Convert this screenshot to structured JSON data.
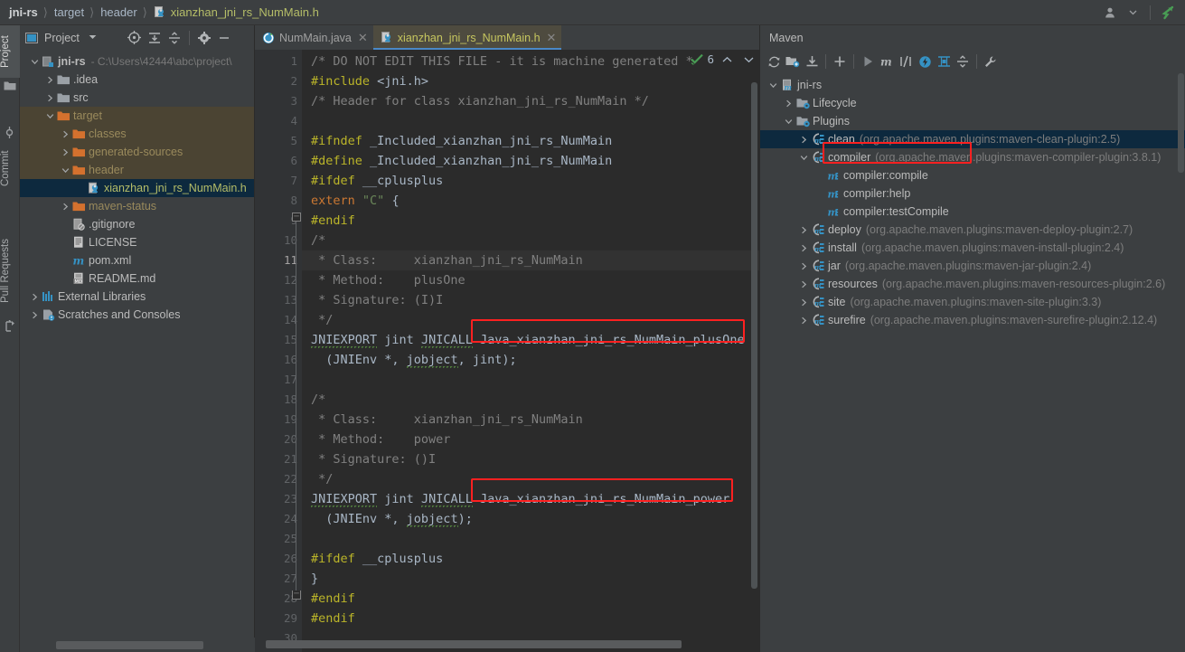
{
  "breadcrumb": {
    "items": [
      {
        "label": "jni-rs",
        "type": "module"
      },
      {
        "label": "target",
        "type": "folder"
      },
      {
        "label": "header",
        "type": "folder"
      },
      {
        "label": "xianzhan_jni_rs_NumMain.h",
        "type": "file"
      }
    ],
    "separator": "〉"
  },
  "topbar_right": {
    "account_icon": "user-icon",
    "chevron": "chevron-down-icon",
    "vcs_icon": "vcs-arrow-icon"
  },
  "left_strip": {
    "items": [
      {
        "label": "Project",
        "active": true,
        "icon": "project-icon"
      },
      {
        "label": "Commit",
        "active": false,
        "icon": "commit-icon"
      },
      {
        "label": "Pull Requests",
        "active": false,
        "icon": "pull-request-icon"
      }
    ]
  },
  "project_panel": {
    "title": "Project",
    "toolbar": [
      {
        "name": "select-opened-file-icon",
        "glyph": "target"
      },
      {
        "name": "expand-all-icon",
        "glyph": "expand"
      },
      {
        "name": "collapse-all-icon",
        "glyph": "collapse"
      },
      {
        "name": "settings-icon",
        "glyph": "gear"
      },
      {
        "name": "hide-icon",
        "glyph": "minus"
      }
    ],
    "tree": [
      {
        "indent": 0,
        "arrow": "down",
        "icon": "module-icon",
        "label": "jni-rs",
        "sub": "- C:\\Users\\42444\\abc\\project\\",
        "bold": true,
        "excluded": false,
        "selected": false
      },
      {
        "indent": 1,
        "arrow": "right",
        "icon": "folder-icon",
        "label": ".idea",
        "sub": "",
        "bold": false,
        "excluded": false,
        "selected": false
      },
      {
        "indent": 1,
        "arrow": "right",
        "icon": "folder-icon",
        "label": "src",
        "sub": "",
        "bold": false,
        "excluded": false,
        "selected": false
      },
      {
        "indent": 1,
        "arrow": "down",
        "icon": "folder-orange-icon",
        "label": "target",
        "sub": "",
        "bold": false,
        "excluded": true,
        "selected": false
      },
      {
        "indent": 2,
        "arrow": "right",
        "icon": "folder-orange-icon",
        "label": "classes",
        "sub": "",
        "bold": false,
        "excluded": true,
        "selected": false
      },
      {
        "indent": 2,
        "arrow": "right",
        "icon": "folder-orange-icon",
        "label": "generated-sources",
        "sub": "",
        "bold": false,
        "excluded": true,
        "selected": false
      },
      {
        "indent": 2,
        "arrow": "down",
        "icon": "folder-orange-icon",
        "label": "header",
        "sub": "",
        "bold": false,
        "excluded": true,
        "selected": false
      },
      {
        "indent": 3,
        "arrow": "none",
        "icon": "header-file-icon",
        "label": "xianzhan_jni_rs_NumMain.h",
        "sub": "",
        "bold": false,
        "excluded": false,
        "selected": true
      },
      {
        "indent": 2,
        "arrow": "right",
        "icon": "folder-orange-icon",
        "label": "maven-status",
        "sub": "",
        "bold": false,
        "excluded": true,
        "selected": false
      },
      {
        "indent": 2,
        "arrow": "none",
        "icon": "gitignore-icon",
        "label": ".gitignore",
        "sub": "",
        "bold": false,
        "excluded": false,
        "selected": false
      },
      {
        "indent": 2,
        "arrow": "none",
        "icon": "text-file-icon",
        "label": "LICENSE",
        "sub": "",
        "bold": false,
        "excluded": false,
        "selected": false
      },
      {
        "indent": 2,
        "arrow": "none",
        "icon": "maven-m-icon",
        "label": "pom.xml",
        "sub": "",
        "bold": false,
        "excluded": false,
        "selected": false
      },
      {
        "indent": 2,
        "arrow": "none",
        "icon": "markdown-icon",
        "label": "README.md",
        "sub": "",
        "bold": false,
        "excluded": false,
        "selected": false
      },
      {
        "indent": 0,
        "arrow": "right",
        "icon": "libraries-icon",
        "label": "External Libraries",
        "sub": "",
        "bold": false,
        "excluded": false,
        "selected": false
      },
      {
        "indent": 0,
        "arrow": "right",
        "icon": "scratches-icon",
        "label": "Scratches and Consoles",
        "sub": "",
        "bold": false,
        "excluded": false,
        "selected": false
      }
    ]
  },
  "editor": {
    "tabs": [
      {
        "label": "NumMain.java",
        "icon": "java-class-icon",
        "active": false,
        "closable": true
      },
      {
        "label": "xianzhan_jni_rs_NumMain.h",
        "icon": "header-file-icon",
        "active": true,
        "closable": true
      }
    ],
    "inspection_widget": {
      "count": "6",
      "icon": "checkmark-green-icon",
      "up": "⌃",
      "down": "⌄"
    },
    "current_line": 11,
    "lines": [
      {
        "n": 1,
        "tokens": [
          {
            "c": "cmt",
            "t": "/* DO NOT EDIT THIS FILE - it is machine generated *"
          }
        ]
      },
      {
        "n": 2,
        "tokens": [
          {
            "c": "pp",
            "t": "#include"
          },
          {
            "c": "txt",
            "t": " <jni.h>"
          }
        ]
      },
      {
        "n": 3,
        "tokens": [
          {
            "c": "cmt",
            "t": "/* Header for class xianzhan_jni_rs_NumMain */"
          }
        ]
      },
      {
        "n": 4,
        "tokens": []
      },
      {
        "n": 5,
        "tokens": [
          {
            "c": "pp",
            "t": "#ifndef"
          },
          {
            "c": "txt",
            "t": " _Included_xianzhan_jni_rs_NumMain"
          }
        ]
      },
      {
        "n": 6,
        "tokens": [
          {
            "c": "pp",
            "t": "#define"
          },
          {
            "c": "txt",
            "t": " _Included_xianzhan_jni_rs_NumMain"
          }
        ]
      },
      {
        "n": 7,
        "tokens": [
          {
            "c": "pp",
            "t": "#ifdef"
          },
          {
            "c": "txt",
            "t": " __cplusplus"
          }
        ]
      },
      {
        "n": 8,
        "tokens": [
          {
            "c": "kw",
            "t": "extern"
          },
          {
            "c": "txt",
            "t": " "
          },
          {
            "c": "str",
            "t": "\"C\""
          },
          {
            "c": "txt",
            "t": " {"
          }
        ]
      },
      {
        "n": 9,
        "tokens": [
          {
            "c": "pp",
            "t": "#endif"
          }
        ]
      },
      {
        "n": 10,
        "tokens": [
          {
            "c": "cmt",
            "t": "/*"
          }
        ]
      },
      {
        "n": 11,
        "tokens": [
          {
            "c": "cmt",
            "t": " * Class:     xianzhan_jni_rs_NumMain"
          }
        ]
      },
      {
        "n": 12,
        "tokens": [
          {
            "c": "cmt",
            "t": " * Method:    plusOne"
          }
        ]
      },
      {
        "n": 13,
        "tokens": [
          {
            "c": "cmt",
            "t": " * Signature: (I)I"
          }
        ]
      },
      {
        "n": 14,
        "tokens": [
          {
            "c": "cmt",
            "t": " */"
          }
        ]
      },
      {
        "n": 15,
        "tokens": [
          {
            "c": "txt wavy",
            "t": "JNIEXPORT"
          },
          {
            "c": "txt",
            "t": " jint "
          },
          {
            "c": "txt wavy",
            "t": "JNICALL"
          },
          {
            "c": "txt",
            "t": " Java_xianzhan_jni_rs_NumMain_plusOne"
          }
        ]
      },
      {
        "n": 16,
        "tokens": [
          {
            "c": "txt",
            "t": "  (JNIEnv *, "
          },
          {
            "c": "txt wavy",
            "t": "jobject"
          },
          {
            "c": "txt",
            "t": ", jint);"
          }
        ]
      },
      {
        "n": 17,
        "tokens": []
      },
      {
        "n": 18,
        "tokens": [
          {
            "c": "cmt",
            "t": "/*"
          }
        ]
      },
      {
        "n": 19,
        "tokens": [
          {
            "c": "cmt",
            "t": " * Class:     xianzhan_jni_rs_NumMain"
          }
        ]
      },
      {
        "n": 20,
        "tokens": [
          {
            "c": "cmt",
            "t": " * Method:    power"
          }
        ]
      },
      {
        "n": 21,
        "tokens": [
          {
            "c": "cmt",
            "t": " * Signature: ()I"
          }
        ]
      },
      {
        "n": 22,
        "tokens": [
          {
            "c": "cmt",
            "t": " */"
          }
        ]
      },
      {
        "n": 23,
        "tokens": [
          {
            "c": "txt wavy",
            "t": "JNIEXPORT"
          },
          {
            "c": "txt",
            "t": " jint "
          },
          {
            "c": "txt wavy",
            "t": "JNICALL"
          },
          {
            "c": "txt",
            "t": " Java_xianzhan_jni_rs_NumMain_power"
          }
        ]
      },
      {
        "n": 24,
        "tokens": [
          {
            "c": "txt",
            "t": "  (JNIEnv *, "
          },
          {
            "c": "txt wavy",
            "t": "jobject"
          },
          {
            "c": "txt",
            "t": ");"
          }
        ]
      },
      {
        "n": 25,
        "tokens": []
      },
      {
        "n": 26,
        "tokens": [
          {
            "c": "pp",
            "t": "#ifdef"
          },
          {
            "c": "txt",
            "t": " __cplusplus"
          }
        ]
      },
      {
        "n": 27,
        "tokens": [
          {
            "c": "txt",
            "t": "}"
          }
        ]
      },
      {
        "n": 28,
        "tokens": [
          {
            "c": "pp",
            "t": "#endif"
          }
        ]
      },
      {
        "n": 29,
        "tokens": [
          {
            "c": "pp",
            "t": "#endif"
          }
        ]
      },
      {
        "n": 30,
        "tokens": []
      }
    ],
    "annotations": [
      {
        "name": "highlight-plusone",
        "label": "Java_xianzhan_jni_rs_NumMain_plusOne",
        "color": "#ff2020"
      },
      {
        "name": "highlight-power",
        "label": "Java_xianzhan_jni_rs_NumMain_power",
        "color": "#ff2020"
      }
    ]
  },
  "maven": {
    "title": "Maven",
    "toolbar": [
      {
        "name": "reload-icon"
      },
      {
        "name": "add-maven-project-icon"
      },
      {
        "name": "download-sources-icon"
      },
      {
        "name": "add-icon"
      },
      {
        "name": "run-icon"
      },
      {
        "name": "execute-maven-goal-icon"
      },
      {
        "name": "toggle-skip-tests-icon"
      },
      {
        "name": "toggle-offline-icon"
      },
      {
        "name": "show-dependencies-icon"
      },
      {
        "name": "collapse-all-icon"
      },
      {
        "name": "settings-wrench-icon"
      }
    ],
    "tree": [
      {
        "indent": 0,
        "arrow": "down",
        "icon": "maven-project-icon",
        "label": "jni-rs",
        "coord": "",
        "selected": false
      },
      {
        "indent": 1,
        "arrow": "right",
        "icon": "phase-folder-icon",
        "label": "Lifecycle",
        "coord": "",
        "selected": false
      },
      {
        "indent": 1,
        "arrow": "down",
        "icon": "phase-folder-icon",
        "label": "Plugins",
        "coord": "",
        "selected": false
      },
      {
        "indent": 2,
        "arrow": "right",
        "icon": "plugin-icon",
        "label": "clean",
        "coord": "(org.apache.maven.plugins:maven-clean-plugin:2.5)",
        "selected": true
      },
      {
        "indent": 2,
        "arrow": "down",
        "icon": "plugin-icon",
        "label": "compiler",
        "coord": "(org.apache.maven.plugins:maven-compiler-plugin:3.8.1)",
        "selected": false
      },
      {
        "indent": 3,
        "arrow": "none",
        "icon": "goal-icon",
        "label": "compiler:compile",
        "coord": "",
        "selected": false,
        "highlighted": true
      },
      {
        "indent": 3,
        "arrow": "none",
        "icon": "goal-icon",
        "label": "compiler:help",
        "coord": "",
        "selected": false
      },
      {
        "indent": 3,
        "arrow": "none",
        "icon": "goal-icon",
        "label": "compiler:testCompile",
        "coord": "",
        "selected": false
      },
      {
        "indent": 2,
        "arrow": "right",
        "icon": "plugin-icon",
        "label": "deploy",
        "coord": "(org.apache.maven.plugins:maven-deploy-plugin:2.7)",
        "selected": false
      },
      {
        "indent": 2,
        "arrow": "right",
        "icon": "plugin-icon",
        "label": "install",
        "coord": "(org.apache.maven.plugins:maven-install-plugin:2.4)",
        "selected": false
      },
      {
        "indent": 2,
        "arrow": "right",
        "icon": "plugin-icon",
        "label": "jar",
        "coord": "(org.apache.maven.plugins:maven-jar-plugin:2.4)",
        "selected": false
      },
      {
        "indent": 2,
        "arrow": "right",
        "icon": "plugin-icon",
        "label": "resources",
        "coord": "(org.apache.maven.plugins:maven-resources-plugin:2.6)",
        "selected": false
      },
      {
        "indent": 2,
        "arrow": "right",
        "icon": "plugin-icon",
        "label": "site",
        "coord": "(org.apache.maven.plugins:maven-site-plugin:3.3)",
        "selected": false
      },
      {
        "indent": 2,
        "arrow": "right",
        "icon": "plugin-icon",
        "label": "surefire",
        "coord": "(org.apache.maven.plugins:maven-surefire-plugin:2.12.4)",
        "selected": false
      }
    ],
    "annotations": [
      {
        "name": "highlight-compiler-compile",
        "label": "compiler:compile",
        "color": "#ff2020"
      }
    ]
  },
  "colors": {
    "panel_bg": "#3c3f41",
    "editor_bg": "#2b2b2b",
    "gutter_bg": "#313335",
    "selection_bg": "#0d293e",
    "excluded_bg": "#4b4433",
    "accent_red": "#ff2020",
    "tab_active_bg": "#4e4b3f",
    "tab_underline": "#4a88c7"
  }
}
